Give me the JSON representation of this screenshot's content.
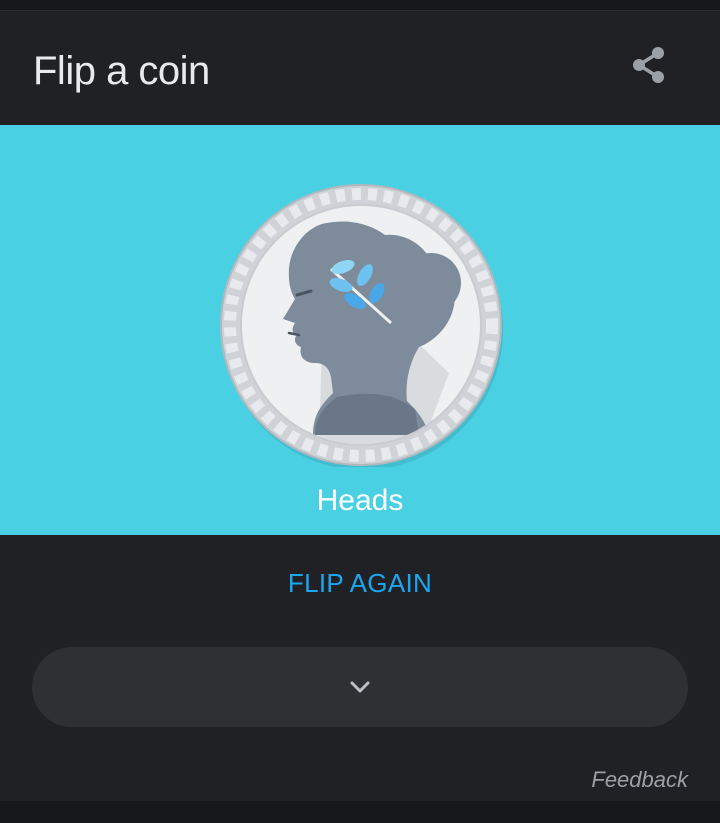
{
  "header": {
    "title": "Flip a coin",
    "share_icon": "share-icon"
  },
  "coin": {
    "face": "heads",
    "result_label": "Heads",
    "stage_color": "#4ad0e3"
  },
  "actions": {
    "flip_again_label": "FLIP AGAIN",
    "flip_again_color": "#1ba6f2",
    "expand_icon": "chevron-down-icon"
  },
  "footer": {
    "feedback_label": "Feedback"
  }
}
